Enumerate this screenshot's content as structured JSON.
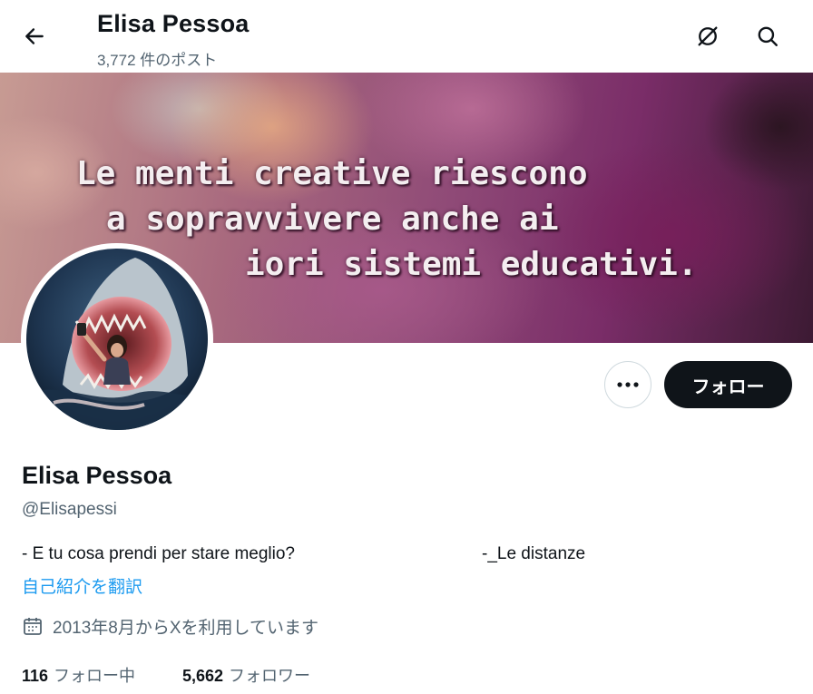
{
  "header": {
    "title": "Elisa Pessoa",
    "post_count": "3,772 件のポスト",
    "back_icon": "arrow-left-icon",
    "hide_icon": "eye-slash-icon",
    "search_icon": "search-icon"
  },
  "banner": {
    "line1": "Le menti creative riescono",
    "line2": "a sopravvivere anche ai",
    "line3": "iori sistemi educativi."
  },
  "actions": {
    "more_icon": "more-icon",
    "follow_label": "フォロー"
  },
  "profile": {
    "name": "Elisa Pessoa",
    "handle": "@Elisapessi",
    "bio_left": "- E tu cosa prendi per stare meglio?",
    "bio_right": "-_Le distanze",
    "translate_label": "自己紹介を翻訳",
    "joined": "2013年8月からXを利用しています",
    "joined_icon": "calendar-icon"
  },
  "stats": {
    "following_count": "116",
    "following_label": "フォロー中",
    "followers_count": "5,662",
    "followers_label": "フォロワー"
  },
  "colors": {
    "text": "#0f1419",
    "secondary": "#536471",
    "link": "#1d9bf0",
    "button_bg": "#0f1419"
  }
}
